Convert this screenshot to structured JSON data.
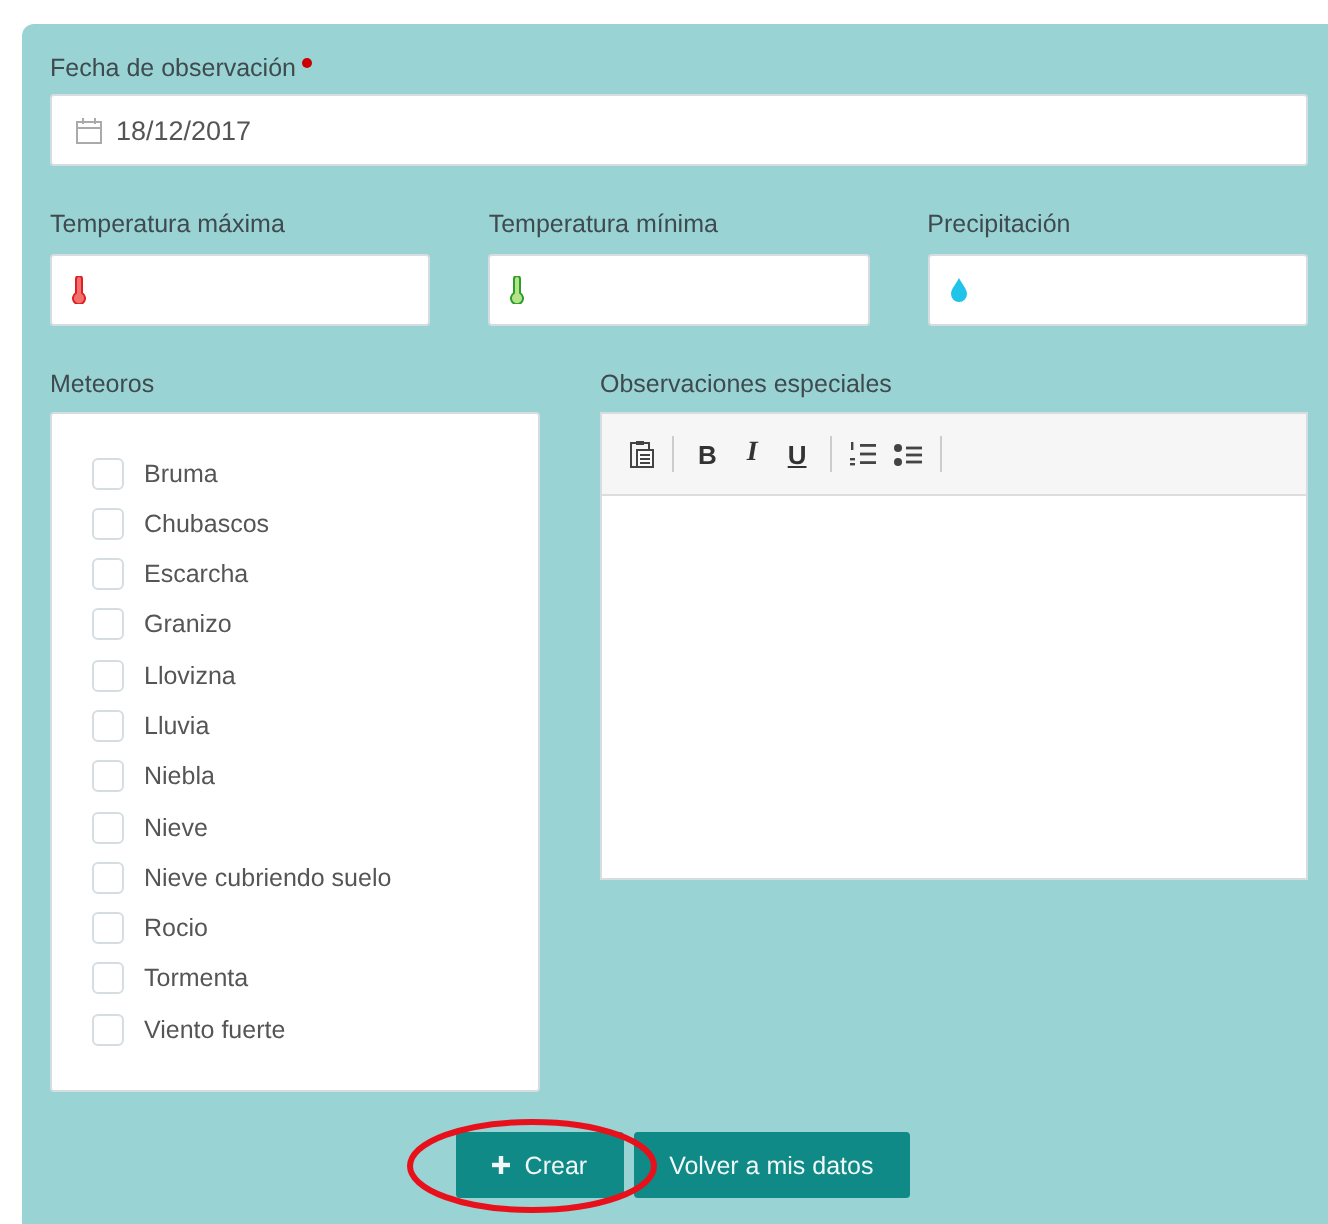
{
  "date_field": {
    "label": "Fecha de observación",
    "required": true,
    "value": "18/12/2017"
  },
  "measure_fields": [
    {
      "label": "Temperatura máxima",
      "kind": "temp_max"
    },
    {
      "label": "Temperatura mínima",
      "kind": "temp_min"
    },
    {
      "label": "Precipitación",
      "kind": "rain"
    }
  ],
  "meteoros": {
    "label": "Meteoros",
    "items": [
      {
        "label": "Bruma",
        "checked": false
      },
      {
        "label": "Chubascos",
        "checked": false
      },
      {
        "label": "Escarcha",
        "checked": false
      },
      {
        "label": "Granizo",
        "checked": false
      },
      {
        "label": "Llovizna",
        "checked": false
      },
      {
        "label": "Lluvia",
        "checked": false
      },
      {
        "label": "Niebla",
        "checked": false
      },
      {
        "label": "Nieve",
        "checked": false
      },
      {
        "label": "Nieve cubriendo suelo",
        "checked": false
      },
      {
        "label": "Rocio",
        "checked": false
      },
      {
        "label": "Tormenta",
        "checked": false
      },
      {
        "label": "Viento fuerte",
        "checked": false
      }
    ]
  },
  "observaciones": {
    "label": "Observaciones especiales",
    "toolbar": [
      {
        "kind": "paste"
      },
      {
        "kind": "separator"
      },
      {
        "kind": "bold",
        "label": "B"
      },
      {
        "kind": "italic",
        "label": "I"
      },
      {
        "kind": "underline",
        "label": "U"
      },
      {
        "kind": "separator"
      },
      {
        "kind": "ordered_list"
      },
      {
        "kind": "bullet_list"
      },
      {
        "kind": "separator"
      }
    ]
  },
  "buttons": [
    {
      "label": "Crear",
      "kind": "create"
    },
    {
      "label": "Volver a mis datos",
      "kind": "back"
    }
  ]
}
